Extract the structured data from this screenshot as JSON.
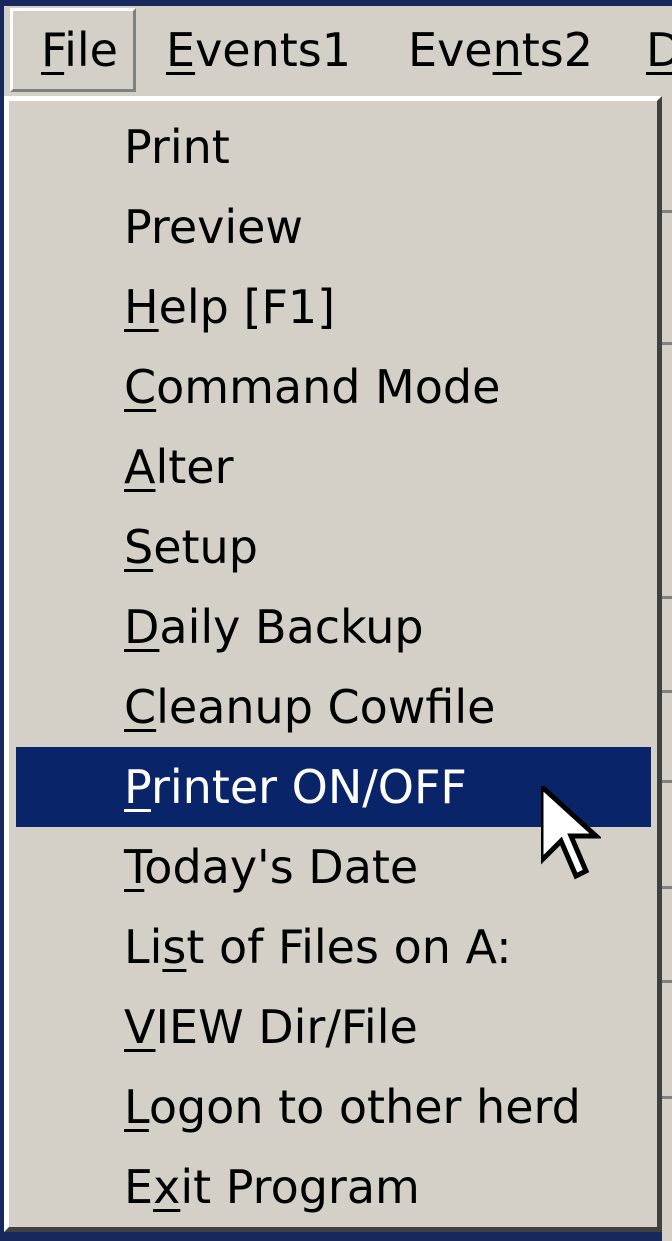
{
  "menubar": {
    "items": [
      {
        "pre": "",
        "key": "F",
        "post": "ile"
      },
      {
        "pre": "",
        "key": "E",
        "post": "vents1"
      },
      {
        "pre": "Eve",
        "key": "n",
        "post": "ts2"
      },
      {
        "pre": "",
        "key": "D",
        "post": ""
      }
    ]
  },
  "menu": {
    "items": [
      {
        "pre": "Print",
        "key": "",
        "post": ""
      },
      {
        "pre": "Preview",
        "key": "",
        "post": ""
      },
      {
        "pre": "",
        "key": "H",
        "post": "elp [F1]"
      },
      {
        "pre": "",
        "key": "C",
        "post": "ommand Mode"
      },
      {
        "pre": "",
        "key": "A",
        "post": "lter"
      },
      {
        "pre": "",
        "key": "S",
        "post": "etup"
      },
      {
        "pre": "",
        "key": "D",
        "post": "aily Backup"
      },
      {
        "pre": "",
        "key": "C",
        "post": "leanup Cowfile"
      },
      {
        "pre": "",
        "key": "P",
        "post": "rinter ON/OFF"
      },
      {
        "pre": "",
        "key": "T",
        "post": "oday's Date"
      },
      {
        "pre": "Li",
        "key": "s",
        "post": "t of Files on A:"
      },
      {
        "pre": "",
        "key": "V",
        "post": "IEW Dir/File"
      },
      {
        "pre": "",
        "key": "L",
        "post": "ogon to other herd"
      },
      {
        "pre": "E",
        "key": "x",
        "post": "it Program"
      }
    ],
    "highlighted_index": 8
  },
  "colors": {
    "desktop": "#16285c",
    "menu_bg": "#d4d0c8",
    "highlight_bg": "#0a246a",
    "highlight_text": "#ffffff"
  },
  "icons": {
    "cursor": "arrow-pointer-icon"
  }
}
